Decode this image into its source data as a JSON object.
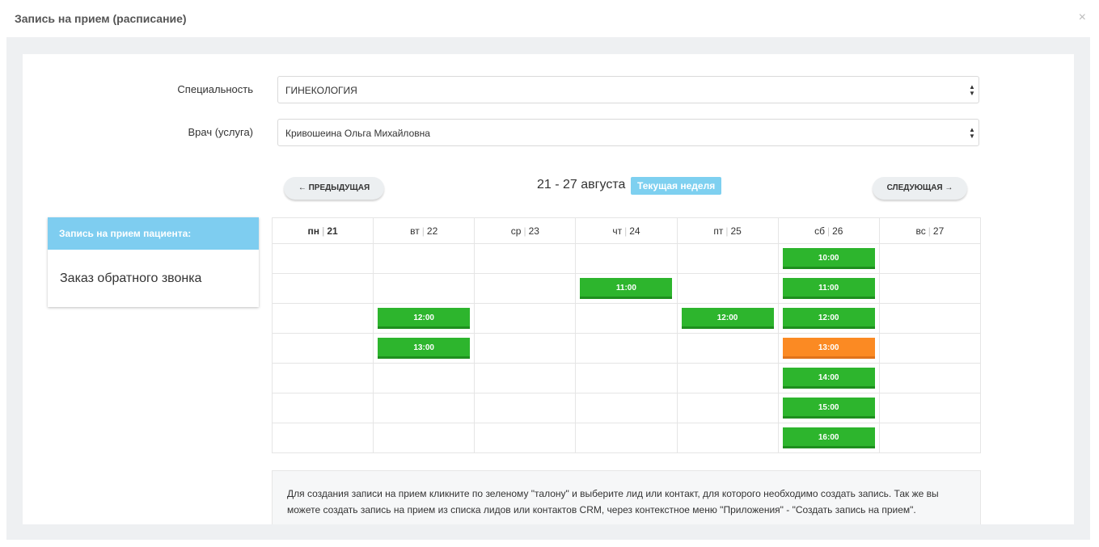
{
  "window": {
    "title": "Запись на прием (расписание)",
    "close": "×"
  },
  "form": {
    "specialty_label": "Специальность",
    "specialty_value": "ГИНЕКОЛОГИЯ",
    "doctor_label": "Врач (услуга)",
    "doctor_value": "Кривошеина Ольга Михайловна"
  },
  "nav": {
    "prev": "← ПРЕДЫДУЩАЯ",
    "next": "СЛЕДУЮЩАЯ →",
    "range": "21 - 27 августа",
    "current_week": "Текущая неделя"
  },
  "sidebar": {
    "header": "Запись на прием пациента:",
    "item": "Заказ обратного звонка"
  },
  "days": [
    {
      "name": "пн",
      "num": "21",
      "today": true
    },
    {
      "name": "вт",
      "num": "22"
    },
    {
      "name": "ср",
      "num": "23"
    },
    {
      "name": "чт",
      "num": "24"
    },
    {
      "name": "пт",
      "num": "25"
    },
    {
      "name": "сб",
      "num": "26"
    },
    {
      "name": "вс",
      "num": "27"
    }
  ],
  "rows": [
    [
      null,
      null,
      null,
      null,
      null,
      {
        "t": "10:00"
      },
      null
    ],
    [
      null,
      null,
      null,
      {
        "t": "11:00"
      },
      null,
      {
        "t": "11:00"
      },
      null
    ],
    [
      null,
      {
        "t": "12:00"
      },
      null,
      null,
      {
        "t": "12:00"
      },
      {
        "t": "12:00"
      },
      null
    ],
    [
      null,
      {
        "t": "13:00"
      },
      null,
      null,
      null,
      {
        "t": "13:00",
        "busy": true
      },
      null
    ],
    [
      null,
      null,
      null,
      null,
      null,
      {
        "t": "14:00"
      },
      null
    ],
    [
      null,
      null,
      null,
      null,
      null,
      {
        "t": "15:00"
      },
      null
    ],
    [
      null,
      null,
      null,
      null,
      null,
      {
        "t": "16:00"
      },
      null
    ]
  ],
  "info": {
    "text": "Для создания записи на прием кликните по зеленому \"талону\" и выберите лид или контакт, для которого необходимо создать запись. Так же вы можете создать запись на прием из списка лидов или контактов CRM, через контекстное меню \"Приложения\" - \"Создать запись на прием\"."
  }
}
